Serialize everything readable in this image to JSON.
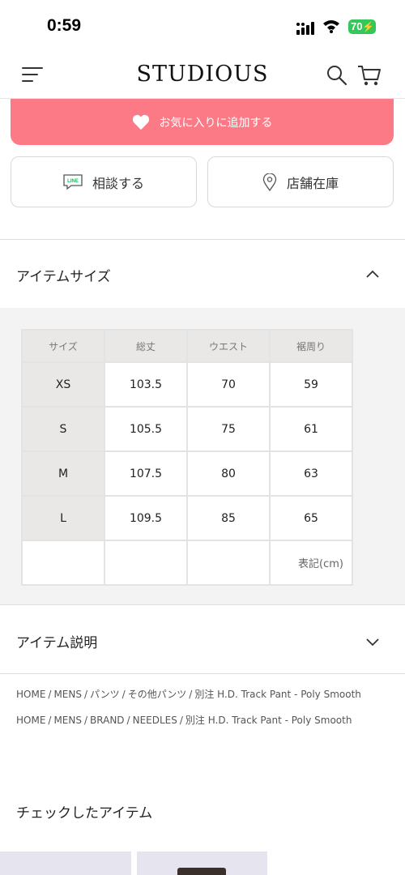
{
  "status": {
    "time": "0:59",
    "battery": "70"
  },
  "header": {
    "logo": "STUDIOUS"
  },
  "favorite_button": "お気に入りに追加する",
  "consult_button": "相談する",
  "consult_icon_text": "LINE",
  "store_stock_button": "店舗在庫",
  "size_section": {
    "title": "アイテムサイズ",
    "columns": [
      "サイズ",
      "総丈",
      "ウエスト",
      "裾周り"
    ],
    "rows": [
      {
        "size": "XS",
        "length": "103.5",
        "waist": "70",
        "hem": "59"
      },
      {
        "size": "S",
        "length": "105.5",
        "waist": "75",
        "hem": "61"
      },
      {
        "size": "M",
        "length": "107.5",
        "waist": "80",
        "hem": "63"
      },
      {
        "size": "L",
        "length": "109.5",
        "waist": "85",
        "hem": "65"
      }
    ],
    "unit_note": "表記(cm)"
  },
  "description_section": {
    "title": "アイテム説明"
  },
  "breadcrumbs": [
    [
      "HOME",
      "MENS",
      "パンツ",
      "その他パンツ",
      "別注 H.D. Track Pant - Poly Smooth"
    ],
    [
      "HOME",
      "MENS",
      "BRAND",
      "NEEDLES",
      "別注 H.D. Track Pant - Poly Smooth"
    ]
  ],
  "checked_items": {
    "title": "チェックしたアイテム"
  },
  "colors": {
    "accent": "#fb7a86",
    "table_header": "#e9e8e6",
    "section_bg": "#f4f3f3"
  }
}
